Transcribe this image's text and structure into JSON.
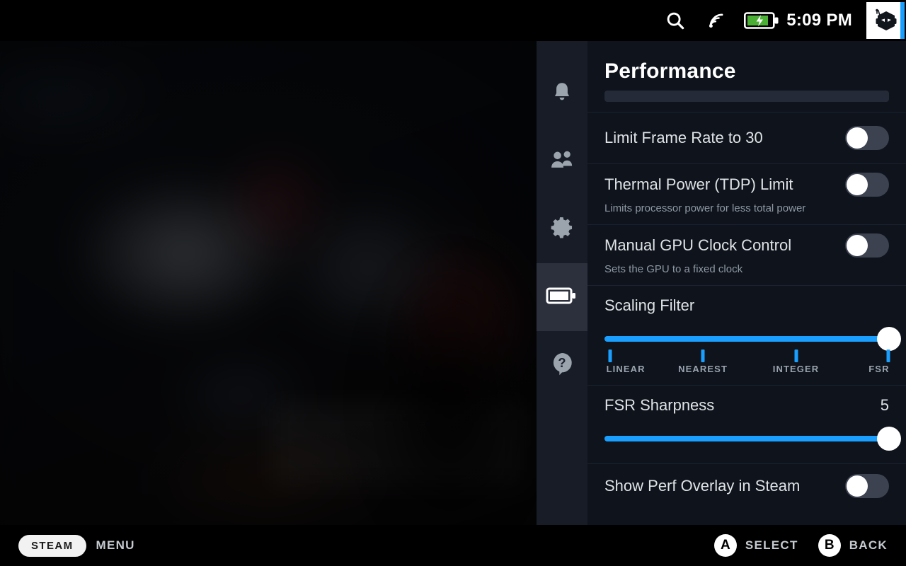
{
  "statusbar": {
    "search_icon": "search-icon",
    "wifi_icon": "wifi-icon",
    "battery_icon": "battery-charging-icon",
    "time": "5:09 PM",
    "avatar_icon": "user-avatar"
  },
  "rail": {
    "items": [
      {
        "id": "notifications",
        "icon": "bell-icon",
        "active": false
      },
      {
        "id": "friends",
        "icon": "friends-icon",
        "active": false
      },
      {
        "id": "settings",
        "icon": "gear-icon",
        "active": false
      },
      {
        "id": "performance",
        "icon": "battery-icon",
        "active": true
      },
      {
        "id": "help",
        "icon": "help-icon",
        "active": false
      }
    ]
  },
  "panel": {
    "title": "Performance",
    "rows": [
      {
        "type": "toggle",
        "name": "limit-frame-rate",
        "label": "Limit Frame Rate to 30",
        "sub": "",
        "value": false
      },
      {
        "type": "toggle",
        "name": "thermal-power-tdp-limit",
        "label": "Thermal Power (TDP) Limit",
        "sub": "Limits processor power for less total power",
        "value": false
      },
      {
        "type": "toggle",
        "name": "manual-gpu-clock-control",
        "label": "Manual GPU Clock Control",
        "sub": "Sets the GPU to a fixed clock",
        "value": false
      },
      {
        "type": "stepslider",
        "name": "scaling-filter",
        "label": "Scaling Filter",
        "value_label": "",
        "options": [
          "LINEAR",
          "NEAREST",
          "INTEGER",
          "FSR"
        ],
        "selected_index": 3
      },
      {
        "type": "slider",
        "name": "fsr-sharpness",
        "label": "FSR Sharpness",
        "value_label": "5",
        "min": 0,
        "max": 5,
        "value": 5
      },
      {
        "type": "toggle",
        "name": "show-perf-overlay-in-steam",
        "label": "Show Perf Overlay in Steam",
        "sub": "",
        "value": false
      }
    ]
  },
  "bottombar": {
    "steam_label": "STEAM",
    "menu_label": "MENU",
    "hints": [
      {
        "button": "A",
        "label": "SELECT"
      },
      {
        "button": "B",
        "label": "BACK"
      }
    ]
  },
  "colors": {
    "accent": "#1a9fff",
    "panel_bg": "#0e131c",
    "rail_bg": "#171c26",
    "rail_active": "#2b303c",
    "battery_green": "#4caf35"
  }
}
